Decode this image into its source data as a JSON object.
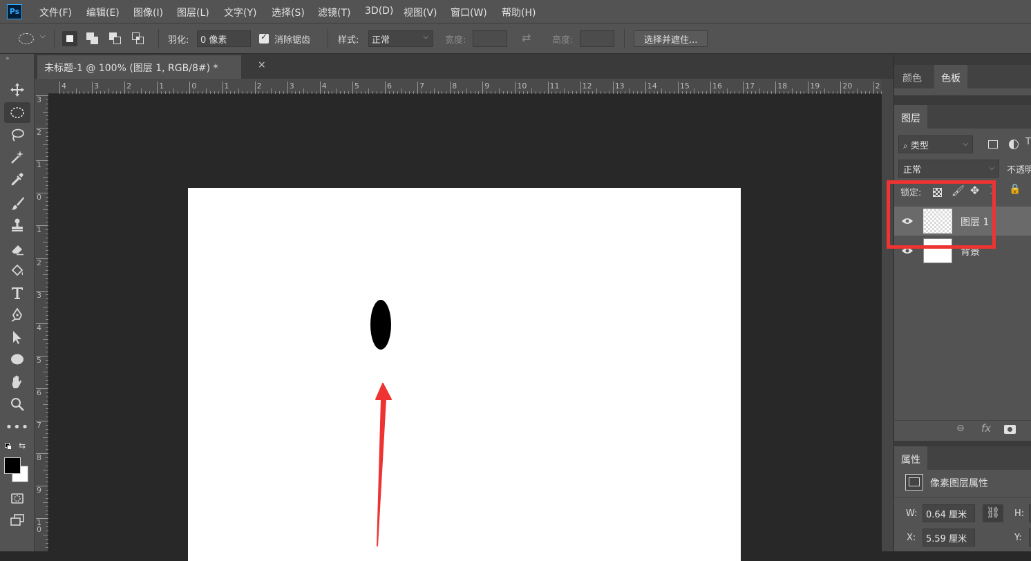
{
  "app": {
    "logo": "Ps"
  },
  "menu": [
    "文件(F)",
    "编辑(E)",
    "图像(I)",
    "图层(L)",
    "文字(Y)",
    "选择(S)",
    "滤镜(T)",
    "3D(D)",
    "视图(V)",
    "窗口(W)",
    "帮助(H)"
  ],
  "options": {
    "feather_label": "羽化:",
    "feather_value": "0 像素",
    "antialias_label": "消除锯齿",
    "antialias_checked": true,
    "style_label": "样式:",
    "style_value": "正常",
    "width_label": "宽度:",
    "height_label": "高度:",
    "select_mask_button": "选择并遮住..."
  },
  "document": {
    "tab_title": "未标题-1 @ 100% (图层 1, RGB/8#) *",
    "close_glyph": "×"
  },
  "ruler": {
    "top_ticks": [
      "4",
      "3",
      "2",
      "1",
      "0",
      "1",
      "2",
      "3",
      "4",
      "5",
      "6",
      "7",
      "8",
      "9",
      "10",
      "11",
      "12",
      "13",
      "14",
      "15",
      "16",
      "17",
      "18",
      "19",
      "20",
      "2"
    ],
    "left_ticks": [
      "3",
      "2",
      "1",
      "0",
      "1",
      "2",
      "3",
      "4",
      "5",
      "6",
      "7",
      "8",
      "9",
      "1\n0"
    ]
  },
  "panels": {
    "color_tabs": [
      "颜色",
      "色板"
    ],
    "layers_tab": "图层",
    "filter_kind": "类型",
    "blend_mode": "正常",
    "opacity_label": "不透明",
    "lock_label": "锁定:",
    "layers": [
      {
        "name": "图层 1",
        "selected": true,
        "transparent": true
      },
      {
        "name": "背景",
        "selected": false,
        "transparent": false
      }
    ],
    "properties_tab": "属性",
    "properties_title": "像素图层属性",
    "w_label": "W:",
    "w_value": "0.64 厘米",
    "h_label": "H:",
    "x_label": "X:",
    "x_value": "5.59 厘米",
    "y_label": "Y:"
  },
  "colors": {
    "highlight_box": "#ee3333",
    "arrow": "#ee3333",
    "ps_blue": "#31a8ff"
  }
}
